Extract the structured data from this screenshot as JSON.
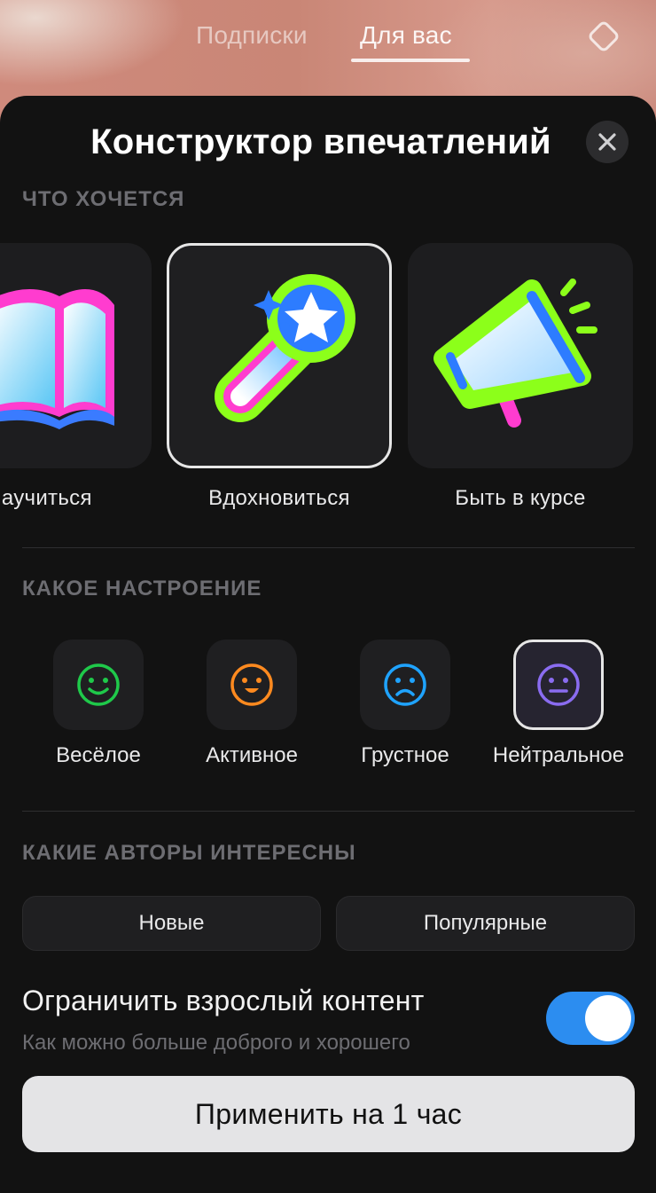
{
  "header": {
    "tabs": [
      {
        "label": "Подписки",
        "active": false
      },
      {
        "label": "Для вас",
        "active": true
      }
    ],
    "right_icon": "diamond-icon"
  },
  "sheet": {
    "title": "Конструктор впечатлений",
    "close_icon": "close-icon",
    "wants": {
      "label": "ЧТО ХОЧЕТСЯ",
      "items": [
        {
          "label": "Научиться",
          "icon": "book-icon",
          "selected": false
        },
        {
          "label": "Вдохновиться",
          "icon": "magic-wand-icon",
          "selected": true
        },
        {
          "label": "Быть в курсе",
          "icon": "megaphone-icon",
          "selected": false
        }
      ]
    },
    "mood": {
      "label": "КАКОЕ НАСТРОЕНИЕ",
      "items": [
        {
          "label": "Весёлое",
          "icon": "happy-face-icon",
          "color": "#1fc94a",
          "selected": false
        },
        {
          "label": "Активное",
          "icon": "excited-face-icon",
          "color": "#ff8a1f",
          "selected": false
        },
        {
          "label": "Грустное",
          "icon": "sad-face-icon",
          "color": "#1fa3ff",
          "selected": false
        },
        {
          "label": "Нейтральное",
          "icon": "neutral-face-icon",
          "color": "#8a6cf0",
          "selected": true
        }
      ]
    },
    "authors": {
      "label": "КАКИЕ АВТОРЫ ИНТЕРЕСНЫ",
      "options": [
        "Новые",
        "Популярные"
      ]
    },
    "restrict": {
      "title": "Ограничить взрослый контент",
      "subtitle": "Как можно больше доброго и хорошего",
      "enabled": true,
      "toggle_color": "#2c8df0"
    },
    "apply_label": "Применить на 1 час"
  }
}
